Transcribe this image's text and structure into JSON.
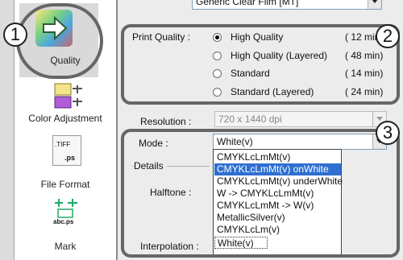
{
  "top_combo": {
    "value": "Generic Clear Film [MT]"
  },
  "sidebar": {
    "items": [
      {
        "label": "Quality"
      },
      {
        "label": "Color Adjustment"
      },
      {
        "label": "File Format"
      },
      {
        "label": "Mark"
      }
    ],
    "icon_texts": {
      "file_format_tiff": ".TIFF",
      "file_format_ps": ".ps",
      "mark_name": "abc.ps"
    }
  },
  "print_quality": {
    "label": "Print Quality :",
    "options": [
      {
        "label": "High Quality",
        "time": "( 12 min )",
        "selected": true
      },
      {
        "label": "High Quality (Layered)",
        "time": "( 48 min)",
        "selected": false
      },
      {
        "label": "Standard",
        "time": "( 14 min)",
        "selected": false
      },
      {
        "label": "Standard (Layered)",
        "time": "( 24 min)",
        "selected": false
      }
    ]
  },
  "resolution": {
    "label": "Resolution :",
    "value": "720 x 1440 dpi"
  },
  "mode": {
    "label": "Mode :",
    "value": "White(v)",
    "options": [
      "CMYKLcLmMt(v)",
      "CMYKLcLmMt(v) onWhite",
      "CMYKLcLmMt(v) underWhite",
      "W -> CMYKLcLmMt(v)",
      "CMYKLcLmMt -> W(v)",
      "MetallicSilver(v)",
      "CMYKLcLm(v)",
      "White(v)"
    ],
    "highlighted": "CMYKLcLmMt(v) onWhite"
  },
  "details": {
    "label": "Details",
    "halftone_label": "Halftone :",
    "interpolation_label": "Interpolation :"
  },
  "callouts": {
    "one": "1",
    "two": "2",
    "three": "3"
  },
  "colors": {
    "selection": "#2f6fd1",
    "callout_border": "#666666",
    "panel": "#ececec"
  }
}
